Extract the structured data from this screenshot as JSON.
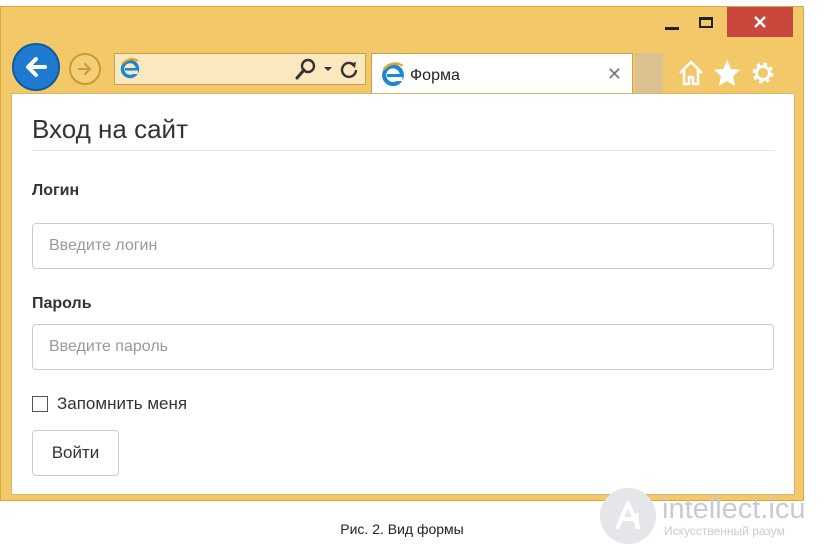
{
  "browser": {
    "tab_title": "Форма",
    "window_controls": {
      "minimize_icon": "minimize-icon",
      "maximize_icon": "maximize-icon",
      "close_icon": "close-icon"
    },
    "icons": [
      "back-arrow-icon",
      "forward-arrow-icon",
      "ie-logo-icon",
      "search-icon",
      "dropdown-caret-icon",
      "refresh-icon",
      "tab-close-icon",
      "home-icon",
      "favorites-star-icon",
      "settings-gear-icon"
    ],
    "colors": {
      "frame": "#f2c868",
      "back_button": "#1e7bd1",
      "close_button": "#c9473d"
    }
  },
  "form": {
    "title": "Вход на сайт",
    "login_label": "Логин",
    "login_placeholder": "Введите логин",
    "password_label": "Пароль",
    "password_placeholder": "Введите пароль",
    "remember_label": "Запомнить меня",
    "remember_checked": false,
    "submit_label": "Войти"
  },
  "caption": "Рис. 2. Вид формы",
  "watermark": {
    "name": "intellect.icu",
    "tagline": "Искусственный разум"
  }
}
